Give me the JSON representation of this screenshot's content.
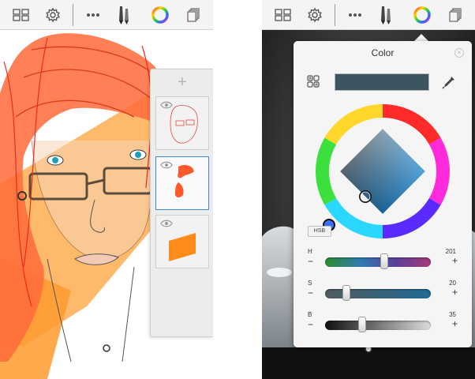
{
  "left_screen": {
    "toolbar": {
      "icons": [
        "grid-icon",
        "gear-icon",
        "more-icon",
        "brush-icon",
        "color-wheel-icon",
        "layers-icon"
      ]
    },
    "layers_panel": {
      "add_label": "+",
      "layers": [
        {
          "name": "sketch-layer",
          "visible": true,
          "selected": false
        },
        {
          "name": "hair-layer",
          "visible": true,
          "selected": true
        },
        {
          "name": "shape-layer",
          "visible": true,
          "selected": false
        }
      ]
    }
  },
  "right_screen": {
    "toolbar": {
      "icons": [
        "grid-icon",
        "gear-icon",
        "more-icon",
        "brush-icon",
        "color-wheel-icon",
        "layers-icon"
      ]
    },
    "color_panel": {
      "title": "Color",
      "close_label": "×",
      "current_color": "#3d5560",
      "mode_button": "HSB",
      "sliders": [
        {
          "name": "H",
          "value": "201",
          "fraction": 0.56
        },
        {
          "name": "S",
          "value": "20",
          "fraction": 0.2
        },
        {
          "name": "B",
          "value": "35",
          "fraction": 0.35
        }
      ],
      "minus_label": "−",
      "plus_label": "+"
    }
  }
}
